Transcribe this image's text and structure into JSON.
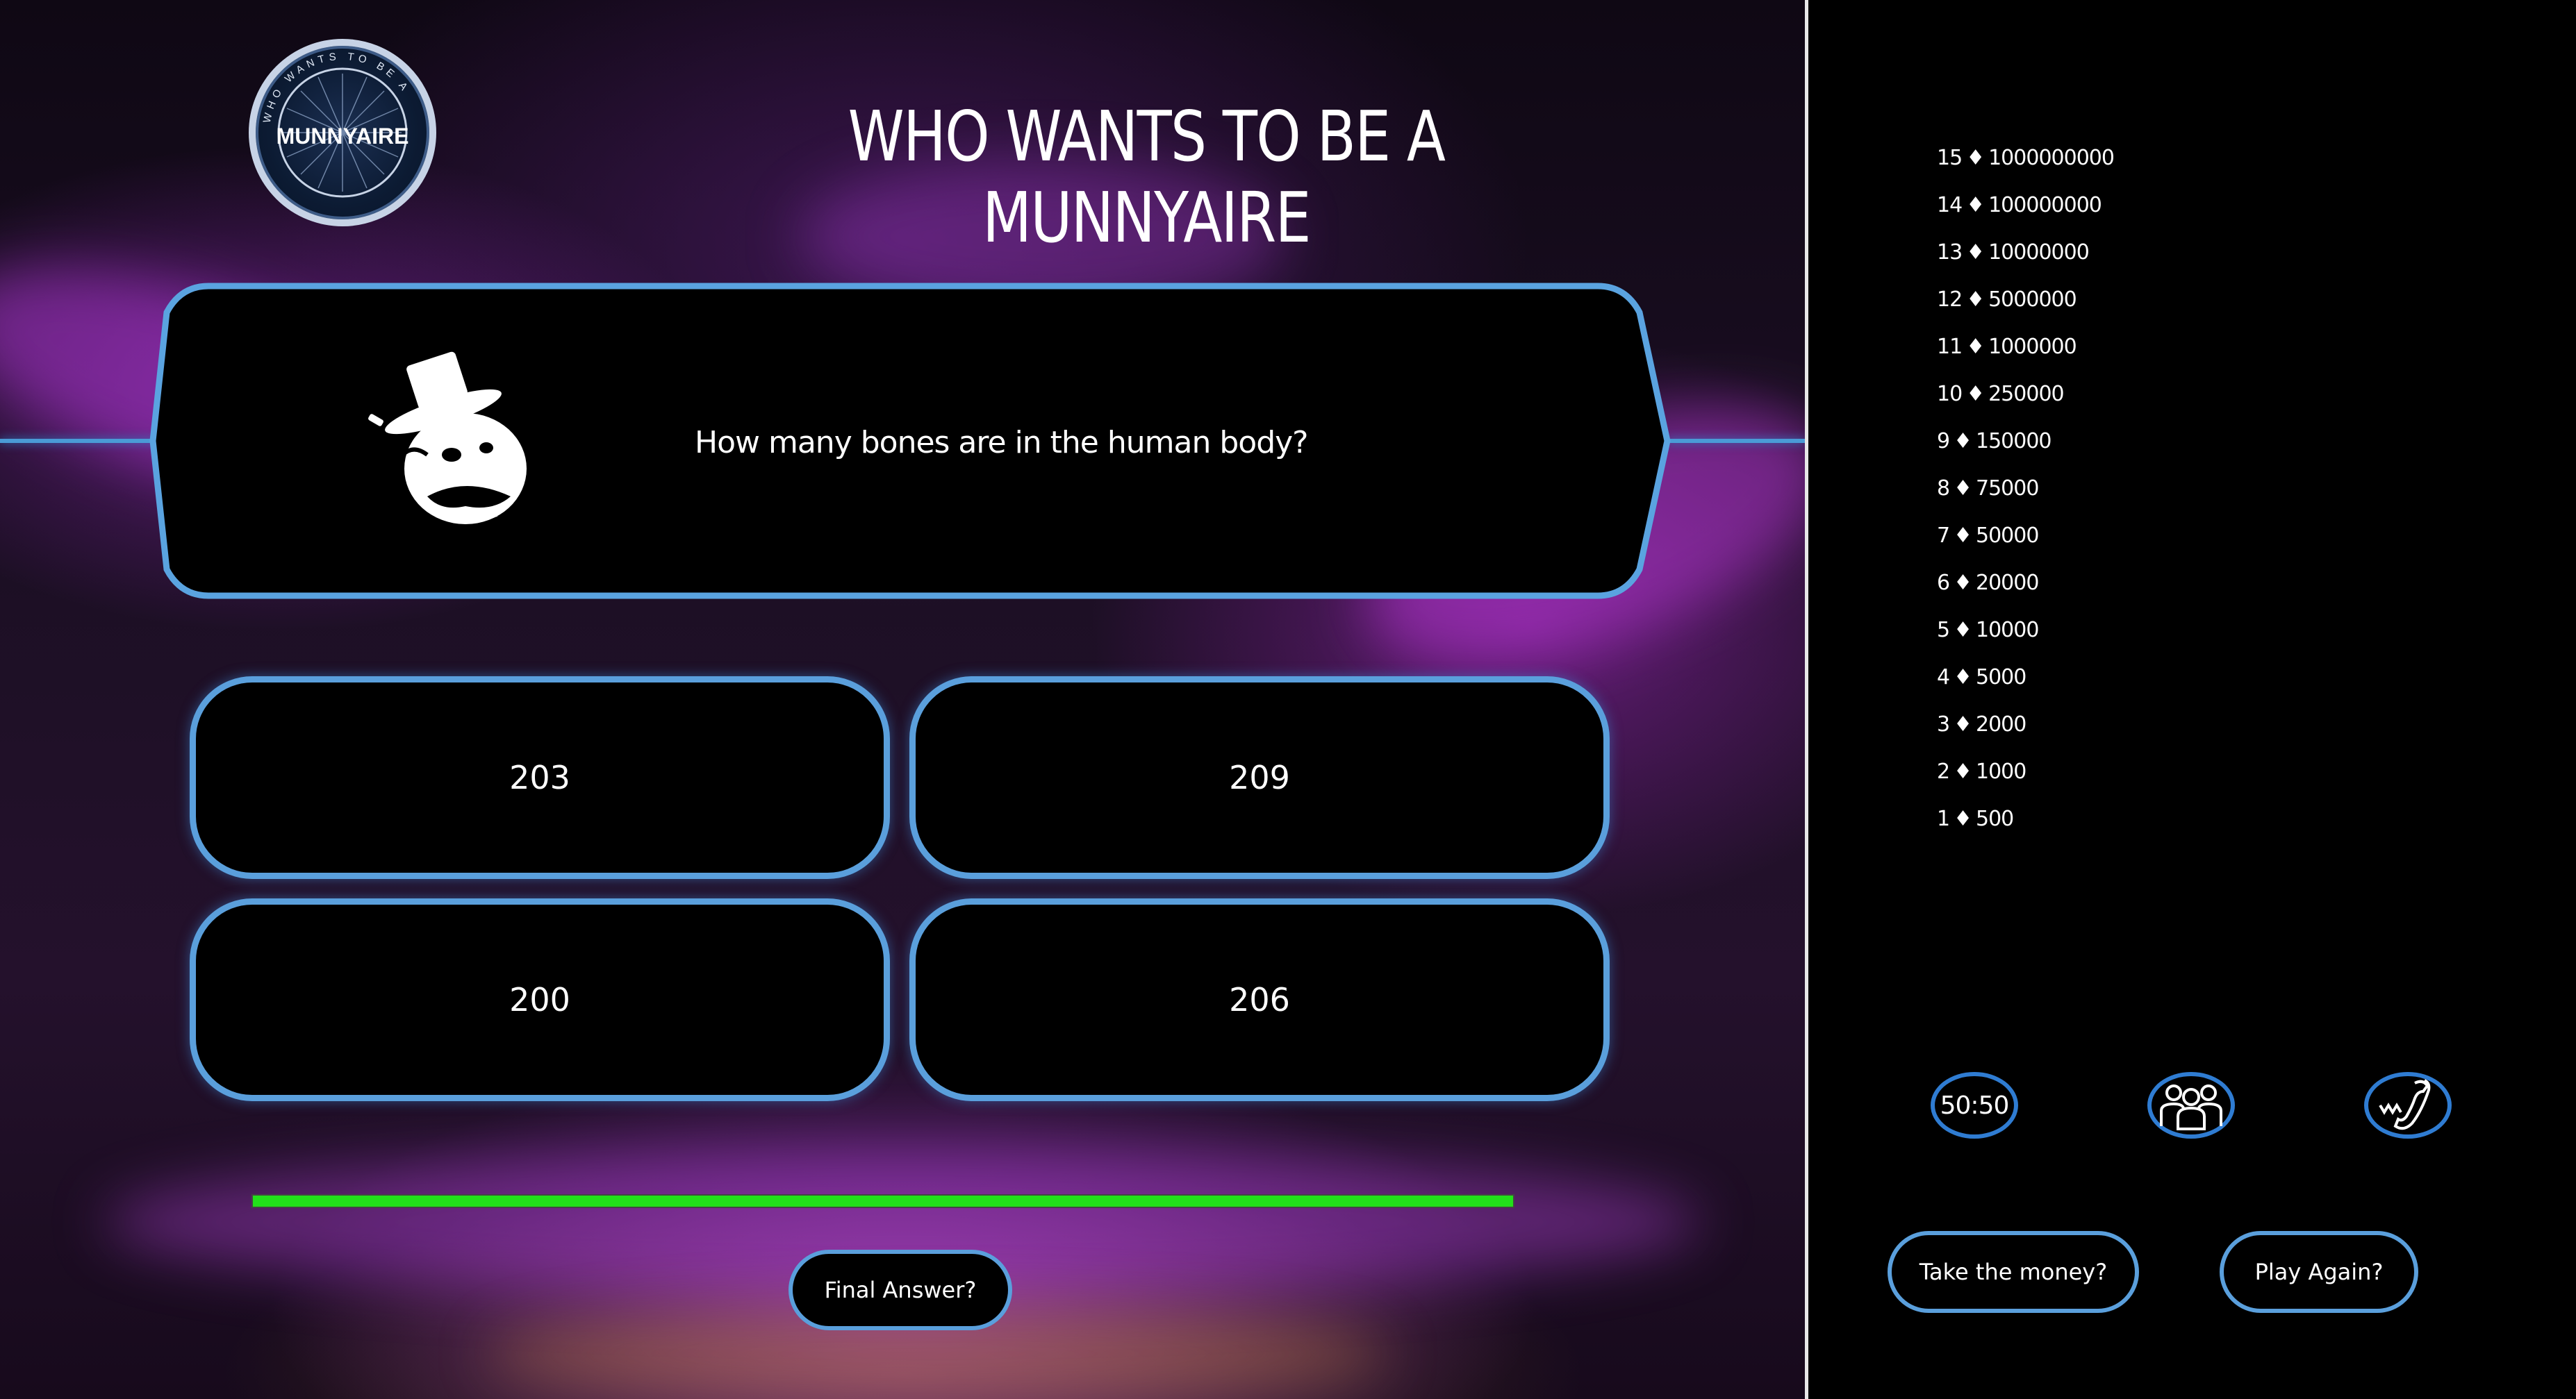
{
  "header": {
    "logo_text": "MUNNYAIRE",
    "logo_ring_text": "WHO WANTS TO BE A",
    "title": "WHO WANTS TO BE A MUNNYAIRE"
  },
  "question": {
    "text": "How many bones are in the human body?",
    "icon": "monopoly-man-icon"
  },
  "answers": [
    {
      "label": "203"
    },
    {
      "label": "209"
    },
    {
      "label": "200"
    },
    {
      "label": "206"
    }
  ],
  "timer": {
    "remaining_fraction": 1.0,
    "color": "#22e01a"
  },
  "final_answer_label": "Final Answer?",
  "money_ladder": [
    {
      "level": "15",
      "amount": "1000000000"
    },
    {
      "level": "14",
      "amount": "100000000"
    },
    {
      "level": "13",
      "amount": "10000000"
    },
    {
      "level": "12",
      "amount": "5000000"
    },
    {
      "level": "11",
      "amount": "1000000"
    },
    {
      "level": "10",
      "amount": "250000"
    },
    {
      "level": "9",
      "amount": "150000"
    },
    {
      "level": "8",
      "amount": "75000"
    },
    {
      "level": "7",
      "amount": "50000"
    },
    {
      "level": "6",
      "amount": "20000"
    },
    {
      "level": "5",
      "amount": "10000"
    },
    {
      "level": "4",
      "amount": "5000"
    },
    {
      "level": "3",
      "amount": "2000"
    },
    {
      "level": "2",
      "amount": "1000"
    },
    {
      "level": "1",
      "amount": "500"
    }
  ],
  "ladder_separator": "♦",
  "lifelines": [
    {
      "name": "fifty-fifty",
      "label": "50:50",
      "icon": "fifty-fifty-icon"
    },
    {
      "name": "ask-the-audience",
      "icon": "audience-icon"
    },
    {
      "name": "phone-a-friend",
      "icon": "phone-icon"
    }
  ],
  "actions": {
    "take_money_label": "Take the money?",
    "play_again_label": "Play Again?"
  },
  "colors": {
    "accent_blue": "#5a9fdc",
    "timer_green": "#22e01a",
    "background": "#000000"
  }
}
